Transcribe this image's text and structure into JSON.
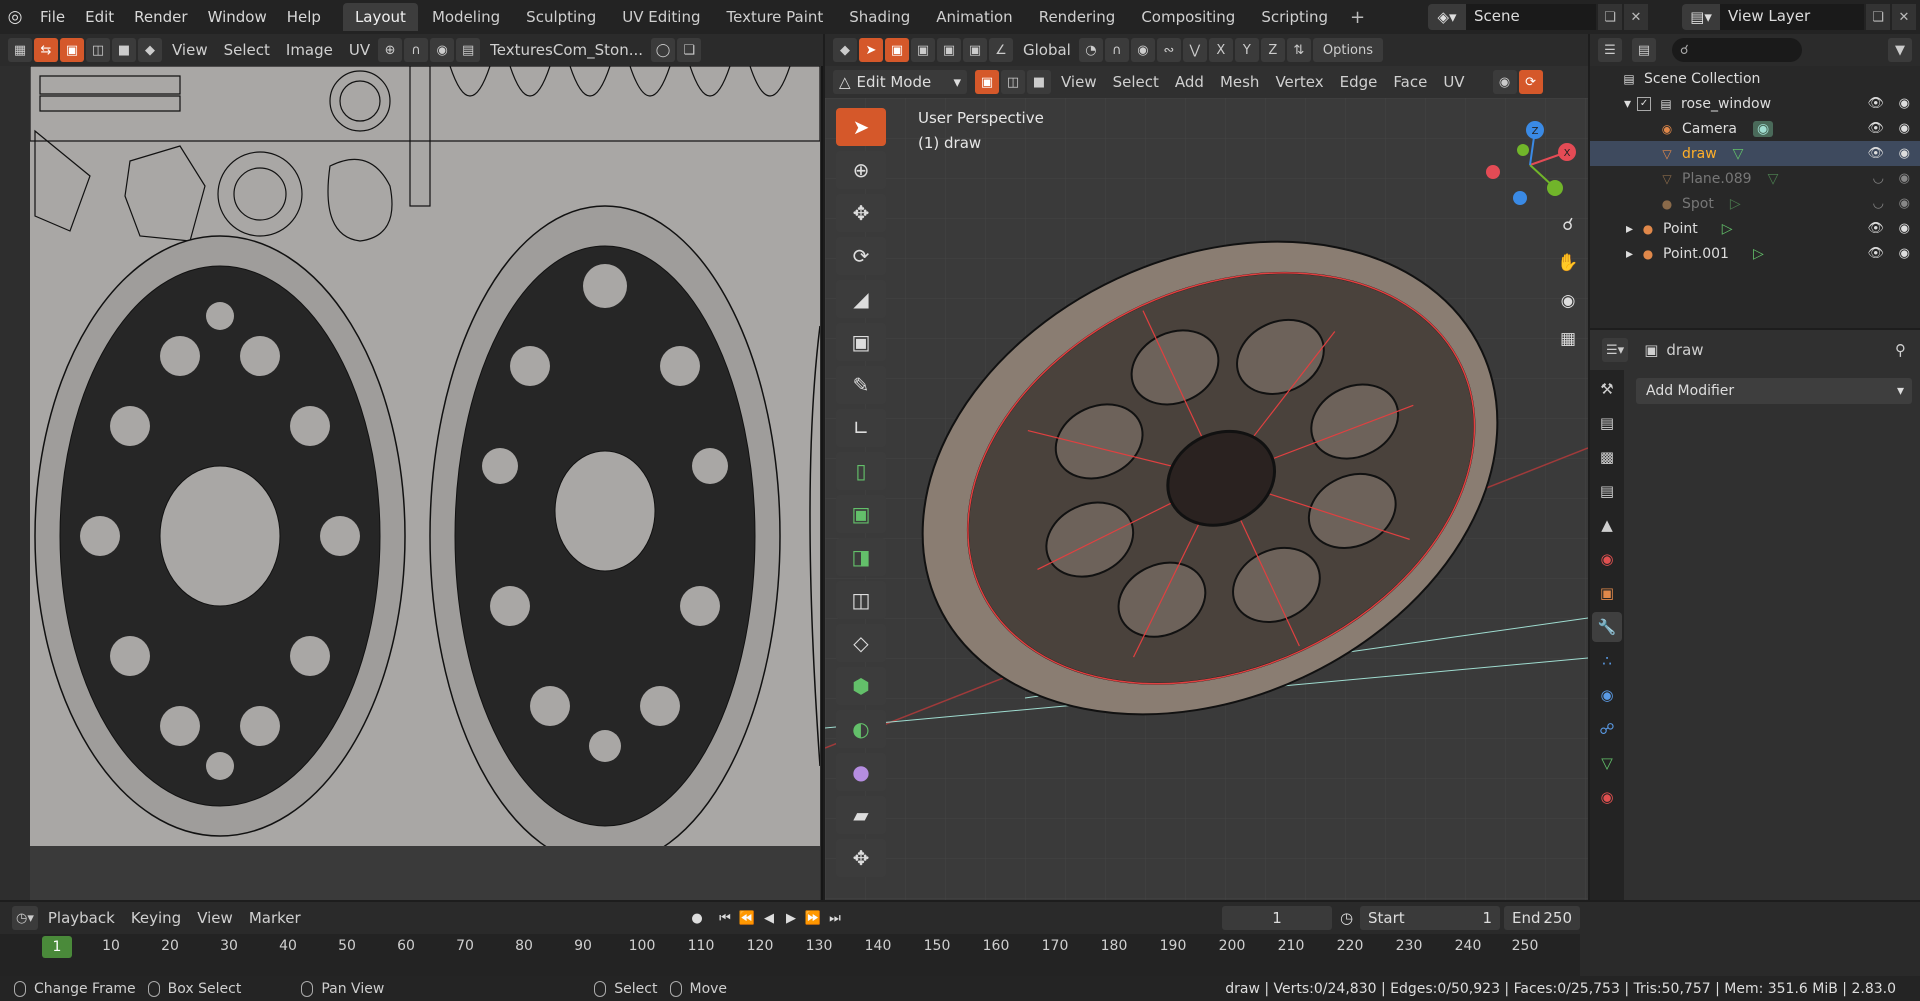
{
  "topbar": {
    "menus": [
      "File",
      "Edit",
      "Render",
      "Window",
      "Help"
    ],
    "workspaces": [
      {
        "label": "Layout",
        "active": true
      },
      {
        "label": "Modeling"
      },
      {
        "label": "Sculpting"
      },
      {
        "label": "UV Editing"
      },
      {
        "label": "Texture Paint"
      },
      {
        "label": "Shading"
      },
      {
        "label": "Animation"
      },
      {
        "label": "Rendering"
      },
      {
        "label": "Compositing"
      },
      {
        "label": "Scripting"
      }
    ],
    "add_workspace": "+",
    "scene_name": "Scene",
    "view_layer": "View Layer"
  },
  "uv_editor": {
    "menus": [
      "View",
      "Select",
      "Image",
      "UV"
    ],
    "image_name": "TexturesCom_Ston..."
  },
  "viewport": {
    "transform_orientation": "Global",
    "options_label": "Options",
    "mode": "Edit Mode",
    "menus": [
      "View",
      "Select",
      "Add",
      "Mesh",
      "Vertex",
      "Edge",
      "Face",
      "UV"
    ],
    "info_line1": "User Perspective",
    "info_line2": "(1) draw",
    "axes": [
      "X",
      "Y",
      "Z"
    ],
    "gizmo": {
      "x": "X",
      "y": "Y",
      "z": "Z"
    }
  },
  "outliner": {
    "root": "Scene Collection",
    "items": [
      {
        "label": "rose_window",
        "depth": 1,
        "type": "collection",
        "icon": "collection-icon"
      },
      {
        "label": "Camera",
        "depth": 2,
        "type": "camera",
        "icon": "camera-object-icon"
      },
      {
        "label": "draw",
        "depth": 2,
        "type": "mesh",
        "selected": true,
        "color": "#ffaf29",
        "icon": "mesh-object-icon"
      },
      {
        "label": "Plane.089",
        "depth": 2,
        "type": "mesh",
        "dimmed": true,
        "icon": "mesh-object-icon"
      },
      {
        "label": "Spot",
        "depth": 2,
        "type": "light",
        "dimmed": true,
        "icon": "light-object-icon"
      },
      {
        "label": "Point",
        "depth": 1,
        "type": "light",
        "icon": "light-object-icon"
      },
      {
        "label": "Point.001",
        "depth": 1,
        "type": "light",
        "icon": "light-object-icon"
      }
    ]
  },
  "properties": {
    "object_name": "draw",
    "add_modifier": "Add Modifier"
  },
  "timeline": {
    "menus": [
      "Playback",
      "Keying",
      "View",
      "Marker"
    ],
    "current_frame": "1",
    "start_label": "Start",
    "start": "1",
    "end_label": "End",
    "end": "250",
    "ruler": [
      "1",
      "10",
      "20",
      "30",
      "40",
      "50",
      "60",
      "70",
      "80",
      "90",
      "100",
      "110",
      "120",
      "130",
      "140",
      "150",
      "160",
      "170",
      "180",
      "190",
      "200",
      "210",
      "220",
      "230",
      "240",
      "250"
    ]
  },
  "statusbar": {
    "hints": [
      "Change Frame",
      "Box Select",
      "Pan View",
      "Select",
      "Move"
    ],
    "stats": "draw | Verts:0/24,830 | Edges:0/50,923 | Faces:0/25,753 | Tris:50,757 | Mem: 351.6 MiB | 2.83.0"
  },
  "colors": {
    "accent": "#d5582a",
    "selected_object": "#ffaf29",
    "current_frame": "#4a8a3a",
    "axis_x": "#e44b55",
    "axis_y": "#71b52a",
    "axis_z": "#3a8ae5"
  }
}
